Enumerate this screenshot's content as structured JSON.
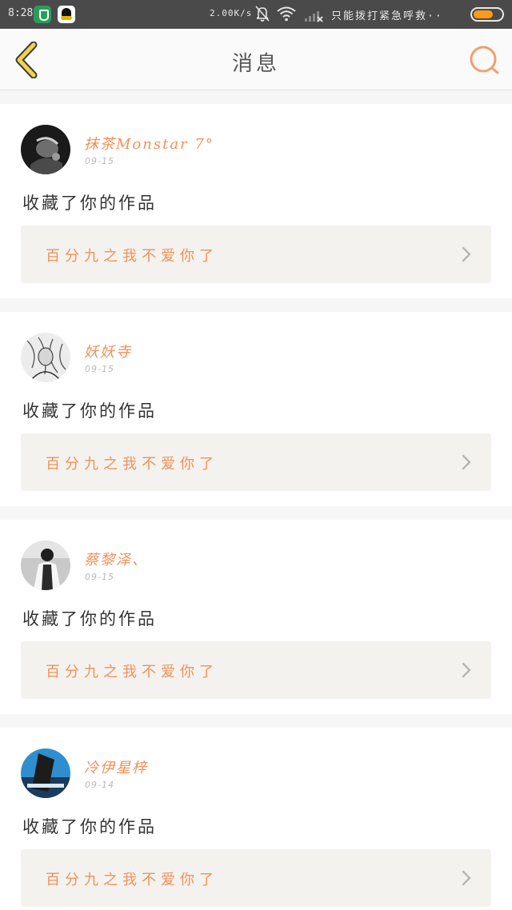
{
  "status_bar": {
    "time": "8:28",
    "network_speed": "2.00K/s",
    "carrier": "只能拨打紧急呼救··",
    "battery_level": 0.72,
    "icons": [
      "shield-app-icon",
      "qq-icon",
      "bell-muted-icon",
      "wifi-icon",
      "signal-icon",
      "battery-icon"
    ]
  },
  "header": {
    "title": "消息",
    "back_icon": "chevron-left-icon",
    "search_icon": "search-icon",
    "accent_color": "#f0915a",
    "back_color": "#f2c94c"
  },
  "messages": [
    {
      "username": "抹茶Monstar 7°",
      "date": "09-15",
      "action": "收藏了你的作品",
      "work_title": "百分九之我不爱你了"
    },
    {
      "username": "妖妖寺",
      "date": "09-15",
      "action": "收藏了你的作品",
      "work_title": "百分九之我不爱你了"
    },
    {
      "username": "蔡黎泽、",
      "date": "09-15",
      "action": "收藏了你的作品",
      "work_title": "百分九之我不爱你了"
    },
    {
      "username": "冷伊星梓",
      "date": "09-14",
      "action": "收藏了你的作品",
      "work_title": "百分九之我不爱你了"
    }
  ]
}
